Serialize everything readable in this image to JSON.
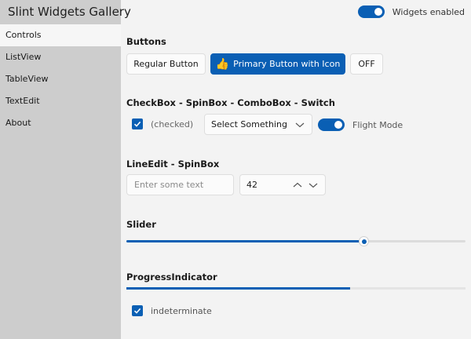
{
  "app": {
    "title": "Slint Widgets Gallery"
  },
  "sidebar": {
    "items": [
      {
        "label": "Controls",
        "active": true
      },
      {
        "label": "ListView",
        "active": false
      },
      {
        "label": "TableView",
        "active": false
      },
      {
        "label": "TextEdit",
        "active": false
      },
      {
        "label": "About",
        "active": false
      }
    ]
  },
  "header": {
    "widgets_enabled_label": "Widgets enabled",
    "widgets_enabled": true
  },
  "buttons": {
    "title": "Buttons",
    "regular_label": "Regular Button",
    "primary_label": "Primary Button with Icon",
    "primary_icon": "👍",
    "toggle_label": "OFF"
  },
  "checkbox_section": {
    "title": "CheckBox - SpinBox - ComboBox - Switch",
    "checkbox_label": "(checked)",
    "checkbox_checked": true,
    "combo_value": "Select Something",
    "switch_label": "Flight Mode",
    "switch_on": true
  },
  "lineedit_section": {
    "title": "LineEdit - SpinBox",
    "lineedit_placeholder": "Enter some text",
    "spinbox_value": "42"
  },
  "slider_section": {
    "title": "Slider",
    "value_fraction": 0.7
  },
  "progress_section": {
    "title": "ProgressIndicator",
    "progress_fraction": 0.66,
    "indeterminate_label": "indeterminate",
    "indeterminate_checked": true
  },
  "colors": {
    "accent": "#0a5fb4",
    "sidebar_bg": "#cdcdcd",
    "content_bg": "#f3f3f3"
  }
}
